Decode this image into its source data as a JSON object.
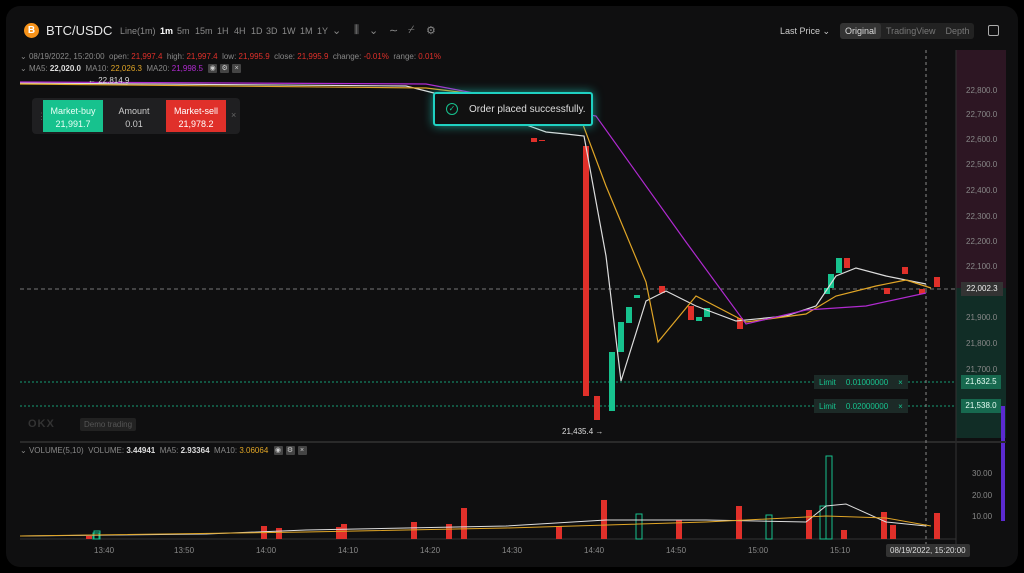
{
  "header": {
    "coin_icon": "B",
    "pair": "BTC/USDC",
    "chart_type": "Line(1m)",
    "timeframes": [
      "1m",
      "5m",
      "15m",
      "1H",
      "4H",
      "1D",
      "3D",
      "1W",
      "1M",
      "1Y"
    ],
    "active_timeframe": "1m",
    "price_source": "Last Price",
    "views": [
      "Original",
      "TradingView",
      "Depth"
    ],
    "active_view": "Original"
  },
  "ohlc": {
    "datetime": "08/19/2022, 15:20:00",
    "open_label": "open:",
    "open": "21,997.4",
    "high_label": "high:",
    "high": "21,997.4",
    "low_label": "low:",
    "low": "21,995.9",
    "close_label": "close:",
    "close": "21,995.9",
    "change_label": "change:",
    "change": "-0.01%",
    "range_label": "range:",
    "range": "0.01%"
  },
  "ma": {
    "ma5_label": "MA5:",
    "ma5": "22,020.0",
    "ma10_label": "MA10:",
    "ma10": "22,026.3",
    "ma20_label": "MA20:",
    "ma20": "21,998.5"
  },
  "trade_panel": {
    "buy_label": "Market-buy",
    "buy_price": "21,991.7",
    "amount_label": "Amount",
    "amount": "0.01",
    "sell_label": "Market-sell",
    "sell_price": "21,978.2"
  },
  "toast": {
    "message": "Order placed successfully."
  },
  "price_axis": [
    "22,800.0",
    "22,700.0",
    "22,600.0",
    "22,500.0",
    "22,400.0",
    "22,300.0",
    "22,200.0",
    "22,100.0",
    "21,900.0",
    "21,800.0",
    "21,700.0"
  ],
  "current_price": "22,002.3",
  "high_marker": "22,814.9",
  "low_marker": "21,435.4",
  "limit_orders": [
    {
      "type": "Limit",
      "qty": "0.01000000",
      "price": "21,632.5"
    },
    {
      "type": "Limit",
      "qty": "0.02000000",
      "price": "21,538.0"
    }
  ],
  "watermark": "OKX",
  "demo_label": "Demo trading",
  "volume": {
    "title": "VOLUME(5,10)",
    "vol_label": "VOLUME:",
    "vol": "3.44941",
    "ma5_label": "MA5:",
    "ma5": "2.93364",
    "ma10_label": "MA10:",
    "ma10": "3.06064",
    "axis": [
      "30.00",
      "20.00",
      "10.00"
    ]
  },
  "time_axis": [
    "13:40",
    "13:50",
    "14:00",
    "14:10",
    "14:20",
    "14:30",
    "14:40",
    "14:50",
    "15:00",
    "15:10"
  ],
  "crosshair_time": "08/19/2022, 15:20:00",
  "colors": {
    "up": "#17c28e",
    "down": "#e0302a",
    "ma5": "#dddddd",
    "ma10": "#e0a526",
    "ma20": "#b02ad0",
    "accent": "#1fd1c2"
  }
}
